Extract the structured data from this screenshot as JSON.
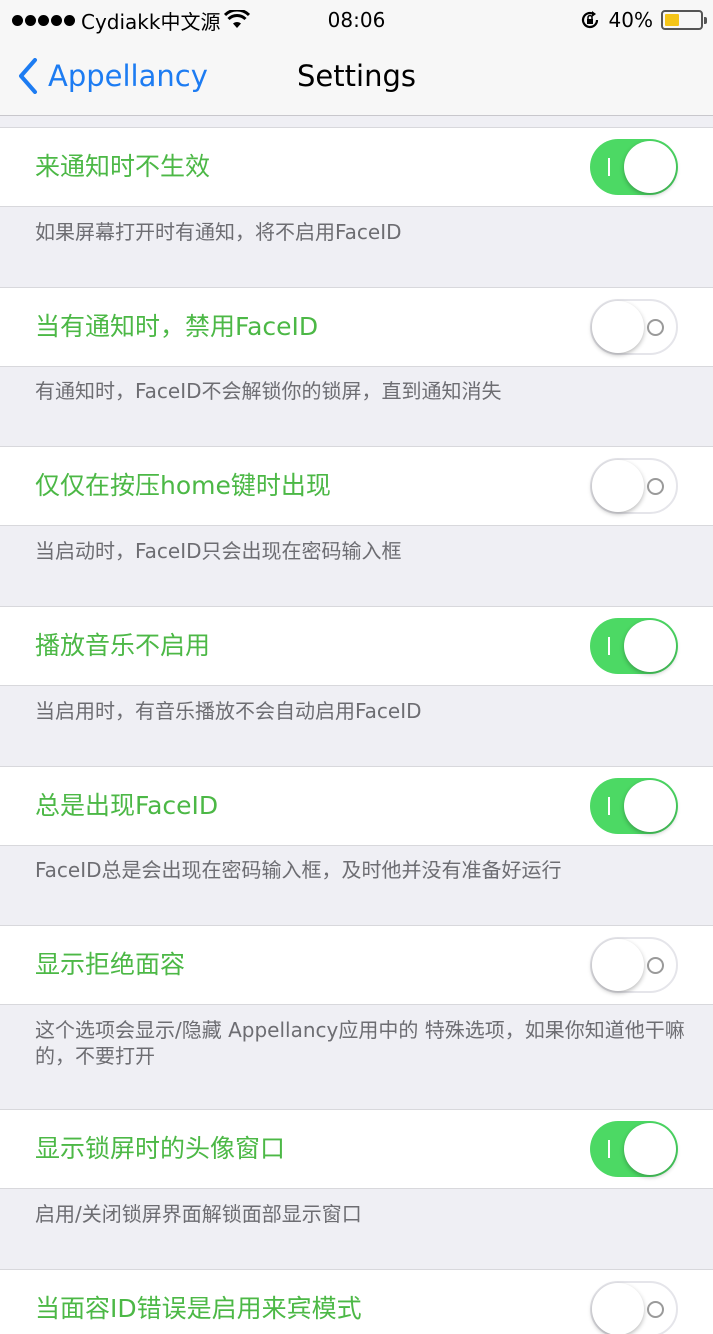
{
  "status_bar": {
    "carrier": "Cydiakk中文源",
    "time": "08:06",
    "battery_percent": "40%",
    "battery_level": 0.4,
    "icons": [
      "signal-dots",
      "wifi-icon",
      "orientation-lock-icon",
      "battery-icon"
    ]
  },
  "nav": {
    "back_label": "Appellancy",
    "title": "Settings"
  },
  "accent_colors": {
    "label_green": "#4cb846",
    "toggle_on": "#4cd964",
    "link_blue": "#1d7cf2"
  },
  "settings": [
    {
      "label": "来通知时不生效",
      "on": true,
      "footnote": "如果屏幕打开时有通知，将不启用FaceID"
    },
    {
      "label": "当有通知时，禁用FaceID",
      "on": false,
      "footnote": "有通知时，FaceID不会解锁你的锁屏，直到通知消失"
    },
    {
      "label": "仅仅在按压home键时出现",
      "on": false,
      "footnote": "当启动时，FaceID只会出现在密码输入框"
    },
    {
      "label": "播放音乐不启用",
      "on": true,
      "footnote": "当启用时，有音乐播放不会自动启用FaceID"
    },
    {
      "label": "总是出现FaceID",
      "on": true,
      "footnote": "FaceID总是会出现在密码输入框，及时他并没有准备好运行"
    },
    {
      "label": "显示拒绝面容",
      "on": false,
      "footnote": "这个选项会显示/隐藏 Appellancy应用中的 特殊选项，如果你知道他干嘛的，不要打开"
    },
    {
      "label": "显示锁屏时的头像窗口",
      "on": true,
      "footnote": "启用/关闭锁屏界面解锁面部显示窗口"
    },
    {
      "label": "当面容ID错误是启用来宾模式",
      "on": false,
      "footnote": ""
    }
  ]
}
